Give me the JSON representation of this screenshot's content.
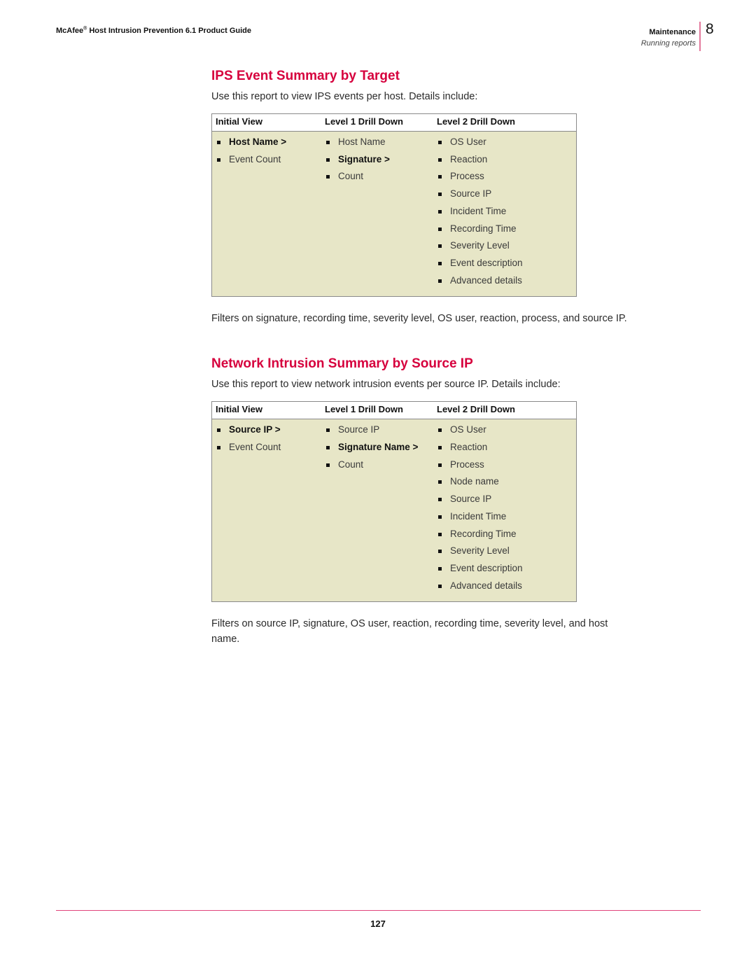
{
  "running_head": {
    "brand": "McAfee",
    "registered_mark": "®",
    "title_rest": " Host Intrusion Prevention 6.1 Product Guide",
    "section": "Maintenance",
    "subsection": "Running reports",
    "chapter_number": "8"
  },
  "sections": [
    {
      "heading": "IPS Event Summary by Target",
      "intro": "Use this report to view IPS events per host. Details include:",
      "table": {
        "headers": [
          "Initial View",
          "Level 1 Drill Down",
          "Level 2 Drill Down"
        ],
        "columns": [
          [
            {
              "text": "Host Name >",
              "strong": true
            },
            {
              "text": "Event Count",
              "strong": false
            }
          ],
          [
            {
              "text": "Host Name",
              "strong": false
            },
            {
              "text": "Signature >",
              "strong": true
            },
            {
              "text": "Count",
              "strong": false
            }
          ],
          [
            {
              "text": "OS User",
              "strong": false
            },
            {
              "text": "Reaction",
              "strong": false
            },
            {
              "text": "Process",
              "strong": false
            },
            {
              "text": "Source IP",
              "strong": false
            },
            {
              "text": "Incident Time",
              "strong": false
            },
            {
              "text": "Recording Time",
              "strong": false
            },
            {
              "text": "Severity Level",
              "strong": false
            },
            {
              "text": "Event description",
              "strong": false
            },
            {
              "text": "Advanced details",
              "strong": false
            }
          ]
        ]
      },
      "filters": "Filters on signature, recording time, severity level, OS user, reaction, process, and source IP."
    },
    {
      "heading": "Network Intrusion Summary by Source IP",
      "intro": "Use this report to view network intrusion events per source IP. Details include:",
      "table": {
        "headers": [
          "Initial View",
          "Level 1 Drill Down",
          "Level 2 Drill Down"
        ],
        "columns": [
          [
            {
              "text": "Source IP >",
              "strong": true
            },
            {
              "text": "Event Count",
              "strong": false
            }
          ],
          [
            {
              "text": "Source IP",
              "strong": false
            },
            {
              "text": "Signature Name >",
              "strong": true
            },
            {
              "text": "Count",
              "strong": false
            }
          ],
          [
            {
              "text": "OS User",
              "strong": false
            },
            {
              "text": "Reaction",
              "strong": false
            },
            {
              "text": "Process",
              "strong": false
            },
            {
              "text": "Node name",
              "strong": false
            },
            {
              "text": "Source IP",
              "strong": false
            },
            {
              "text": "Incident Time",
              "strong": false
            },
            {
              "text": "Recording Time",
              "strong": false
            },
            {
              "text": "Severity Level",
              "strong": false
            },
            {
              "text": "Event description",
              "strong": false
            },
            {
              "text": "Advanced details",
              "strong": false
            }
          ]
        ]
      },
      "filters": "Filters on source IP, signature, OS user, reaction, recording time, severity level, and host name."
    }
  ],
  "footer": {
    "page_number": "127"
  },
  "colors": {
    "heading": "#d6003d",
    "rule": "#e0457b",
    "table_fill": "#e7e6c7"
  }
}
